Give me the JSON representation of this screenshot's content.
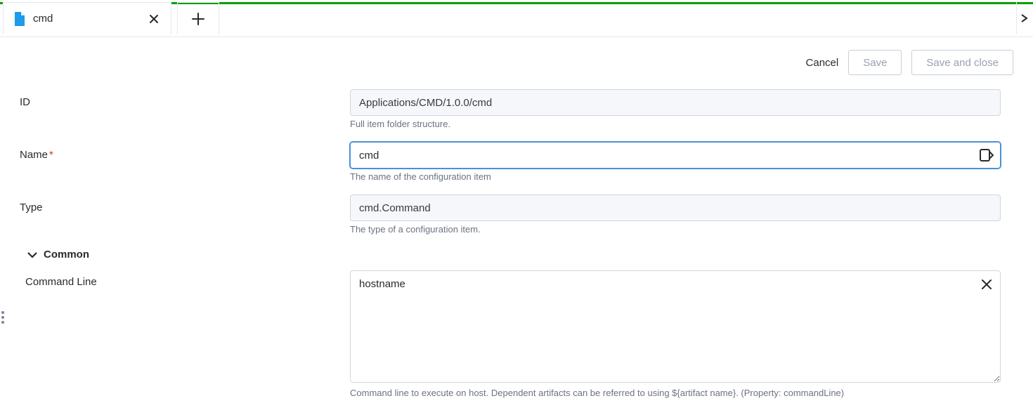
{
  "tabs": {
    "active": {
      "label": "cmd"
    }
  },
  "actions": {
    "cancel": "Cancel",
    "save": "Save",
    "save_and_close": "Save and close"
  },
  "form": {
    "id": {
      "label": "ID",
      "value": "Applications/CMD/1.0.0/cmd",
      "help": "Full item folder structure."
    },
    "name": {
      "label": "Name",
      "required_marker": "*",
      "value": "cmd",
      "help": "The name of the configuration item"
    },
    "type": {
      "label": "Type",
      "value": "cmd.Command",
      "help": "The type of a configuration item."
    }
  },
  "sections": {
    "common": {
      "label": "Common",
      "command_line": {
        "label": "Command Line",
        "value": "hostname",
        "help": "Command line to execute on host. Dependent artifacts can be referred to using ${artifact name}. (Property: commandLine)"
      }
    }
  }
}
